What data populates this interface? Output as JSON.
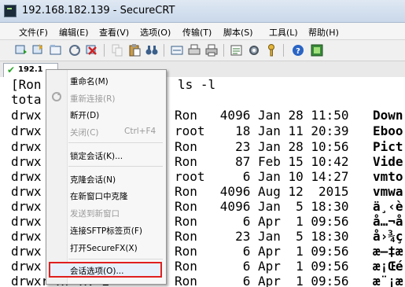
{
  "window": {
    "title": "192.168.182.139 - SecureCRT"
  },
  "menu": [
    "文件(F)",
    "编辑(E)",
    "查看(V)",
    "选项(O)",
    "传输(T)",
    "脚本(S)",
    "工具(L)",
    "帮助(H)"
  ],
  "tab": {
    "label": "192.1"
  },
  "context_menu": {
    "items": [
      {
        "label": "重命名(M)",
        "disabled": false
      },
      {
        "label": "重新连接(R)",
        "disabled": true
      },
      {
        "label": "断开(D)",
        "disabled": false
      },
      {
        "label": "关闭(C)",
        "shortcut": "Ctrl+F4",
        "disabled": true
      },
      {
        "label": "锁定会话(K)...",
        "disabled": false
      },
      {
        "label": "克隆会话(N)",
        "disabled": false
      },
      {
        "label": "在新窗口中克隆",
        "disabled": false
      },
      {
        "label": "发送到新窗口",
        "disabled": true
      },
      {
        "label": "连接SFTP标签页(F)",
        "disabled": false
      },
      {
        "label": "打开SecureFX(X)",
        "disabled": false
      },
      {
        "label": "会话选项(O)...",
        "disabled": false,
        "highlighted": true
      }
    ]
  },
  "terminal": {
    "lines": [
      {
        "left": "[Ron",
        "right": "ls -l"
      },
      {
        "left": "tota",
        "right": ""
      },
      {
        "left": "drwx",
        "right": "Ron   4096 Jan 28 11:50 ",
        "name": "Down"
      },
      {
        "left": "drwx",
        "right": "root    18 Jan 11 20:39 ",
        "name": "Eboo"
      },
      {
        "left": "drwx",
        "right": "Ron     23 Jan 28 10:56 ",
        "name": "Pict"
      },
      {
        "left": "drwx",
        "right": "Ron     87 Feb 15 10:42 ",
        "name": "Vide"
      },
      {
        "left": "drwx",
        "right": "root     6 Jan 10 14:27 ",
        "name": "vmto"
      },
      {
        "left": "drwx",
        "right": "Ron   4096 Aug 12  2015 ",
        "name": "vmwa"
      },
      {
        "left": "drwx",
        "right": "Ron   4096 Jan  5 18:30 ",
        "name": "ä¸‹è"
      },
      {
        "left": "drwx",
        "right": "Ron      6 Apr  1 09:56 ",
        "name": "å…¬å"
      },
      {
        "left": "drwx",
        "right": "Ron     23 Jan  5 18:30 ",
        "name": "å›¾ç"
      },
      {
        "left": "drwx",
        "right": "Ron      6 Apr  1 09:56 ",
        "name": "æ–‡æ"
      },
      {
        "left": "drwx",
        "right": "Ron      6 Apr  1 09:56 ",
        "name": "æ¡Œé"
      },
      {
        "left": "drwxr-xr-x. 2",
        "right": "Ron      6 Apr  1 09:56 ",
        "name": "æ¨¡æ"
      }
    ]
  }
}
